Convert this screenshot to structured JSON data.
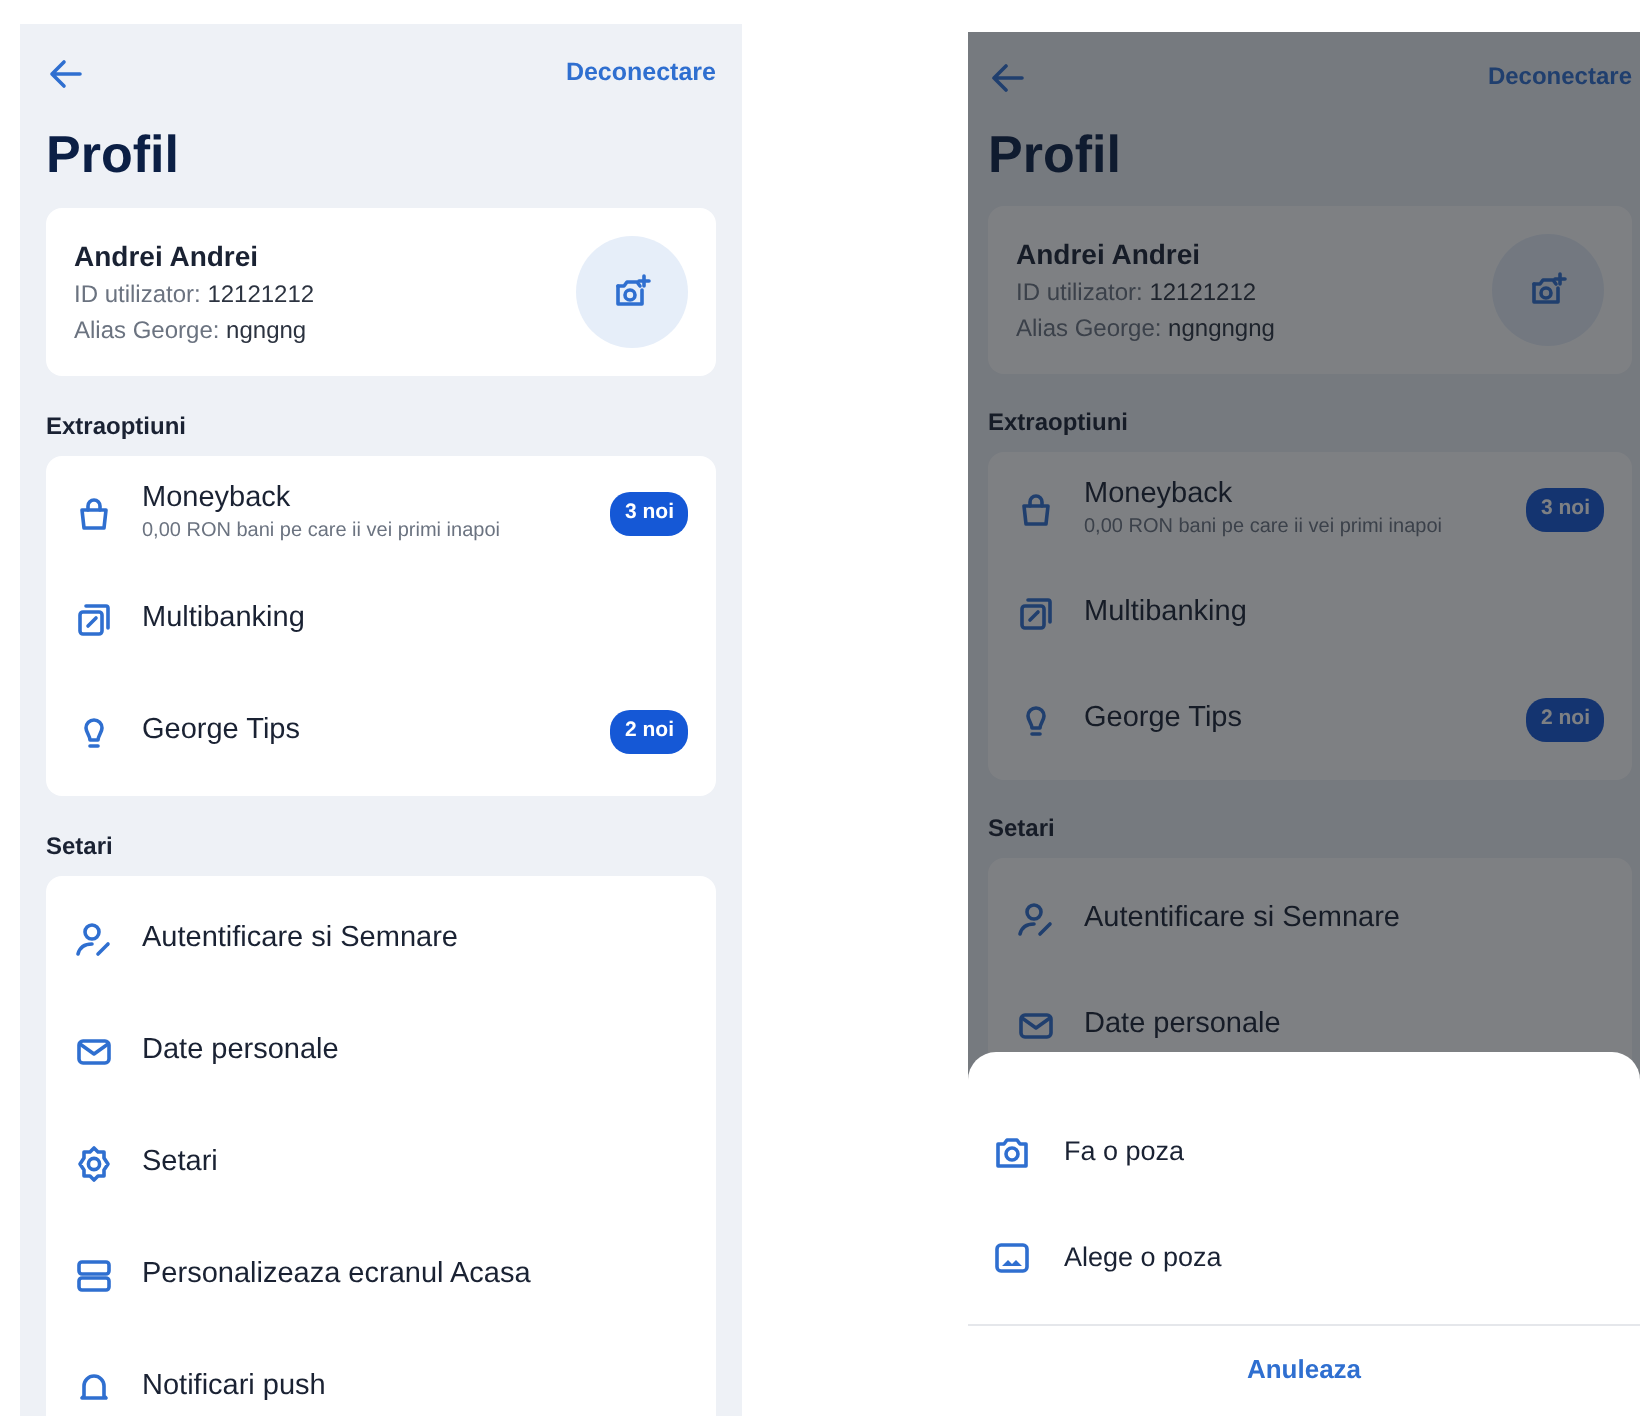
{
  "screens": [
    {
      "logout": "Deconectare",
      "title": "Profil",
      "profile": {
        "name": "Andrei Andrei",
        "id_label": "ID utilizator:",
        "id_value": "12121212",
        "alias_label": "Alias George:",
        "alias_value": "ngngng"
      },
      "sections": [
        {
          "title": "Extraoptiuni",
          "items": [
            {
              "label": "Moneyback",
              "subtitle": "0,00 RON bani pe care ii vei primi inapoi",
              "badge": "3 noi"
            },
            {
              "label": "Multibanking"
            },
            {
              "label": "George Tips",
              "badge": "2 noi"
            }
          ]
        },
        {
          "title": "Setari",
          "items": [
            {
              "label": "Autentificare si Semnare"
            },
            {
              "label": "Date personale"
            },
            {
              "label": "Setari"
            },
            {
              "label": "Personalizeaza ecranul Acasa"
            },
            {
              "label": "Notificari push"
            }
          ]
        }
      ]
    },
    {
      "logout": "Deconectare",
      "title": "Profil",
      "profile": {
        "name": "Andrei Andrei",
        "id_label": "ID utilizator:",
        "id_value": "12121212",
        "alias_label": "Alias George:",
        "alias_value": "ngngngng"
      },
      "sections": [
        {
          "title": "Extraoptiuni",
          "items": [
            {
              "label": "Moneyback",
              "subtitle": "0,00 RON bani pe care ii vei primi inapoi",
              "badge": "3 noi"
            },
            {
              "label": "Multibanking"
            },
            {
              "label": "George Tips",
              "badge": "2 noi"
            }
          ]
        },
        {
          "title": "Setari",
          "items": [
            {
              "label": "Autentificare si Semnare"
            },
            {
              "label": "Date personale"
            }
          ]
        }
      ],
      "sheet": {
        "options": [
          {
            "label": "Fa o poza"
          },
          {
            "label": "Alege o poza"
          }
        ],
        "cancel": "Anuleaza"
      }
    }
  ]
}
